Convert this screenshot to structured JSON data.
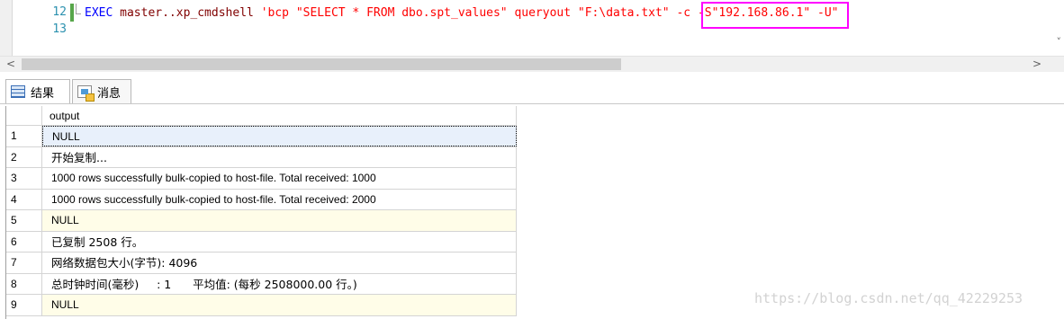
{
  "editor": {
    "line_numbers": [
      "12",
      "13"
    ],
    "code_line": {
      "kw": "EXEC",
      "fn": "master..xp_cmdshell",
      "str1": "'bcp \"SELECT * FROM dbo.spt_values\" queryout ",
      "str2": "\"F:\\data.txt\"",
      "str3": " -c -S\"192.168.86.1\" -U\""
    },
    "highlight_color": "#ff00ff"
  },
  "scrollbar": {
    "left_arrow": "<",
    "right_arrow": ">",
    "down_arrow": "˅"
  },
  "tabs": [
    {
      "label": "结果",
      "icon": "grid-icon",
      "active": true
    },
    {
      "label": "消息",
      "icon": "message-icon",
      "active": false
    }
  ],
  "results": {
    "column": "output",
    "rows": [
      {
        "n": "1",
        "value": "NULL"
      },
      {
        "n": "2",
        "value": "开始复制..."
      },
      {
        "n": "3",
        "value": "1000 rows successfully bulk-copied to host-file. Total received: 1000"
      },
      {
        "n": "4",
        "value": "1000 rows successfully bulk-copied to host-file. Total received: 2000"
      },
      {
        "n": "5",
        "value": "NULL"
      },
      {
        "n": "6",
        "value": "已复制 2508 行。"
      },
      {
        "n": "7",
        "value": "网络数据包大小(字节): 4096"
      },
      {
        "n": "8",
        "value": "总时钟时间(毫秒)     : 1      平均值: (每秒 2508000.00 行。)"
      },
      {
        "n": "9",
        "value": "NULL"
      }
    ]
  },
  "watermark": "https://blog.csdn.net/qq_42229253"
}
